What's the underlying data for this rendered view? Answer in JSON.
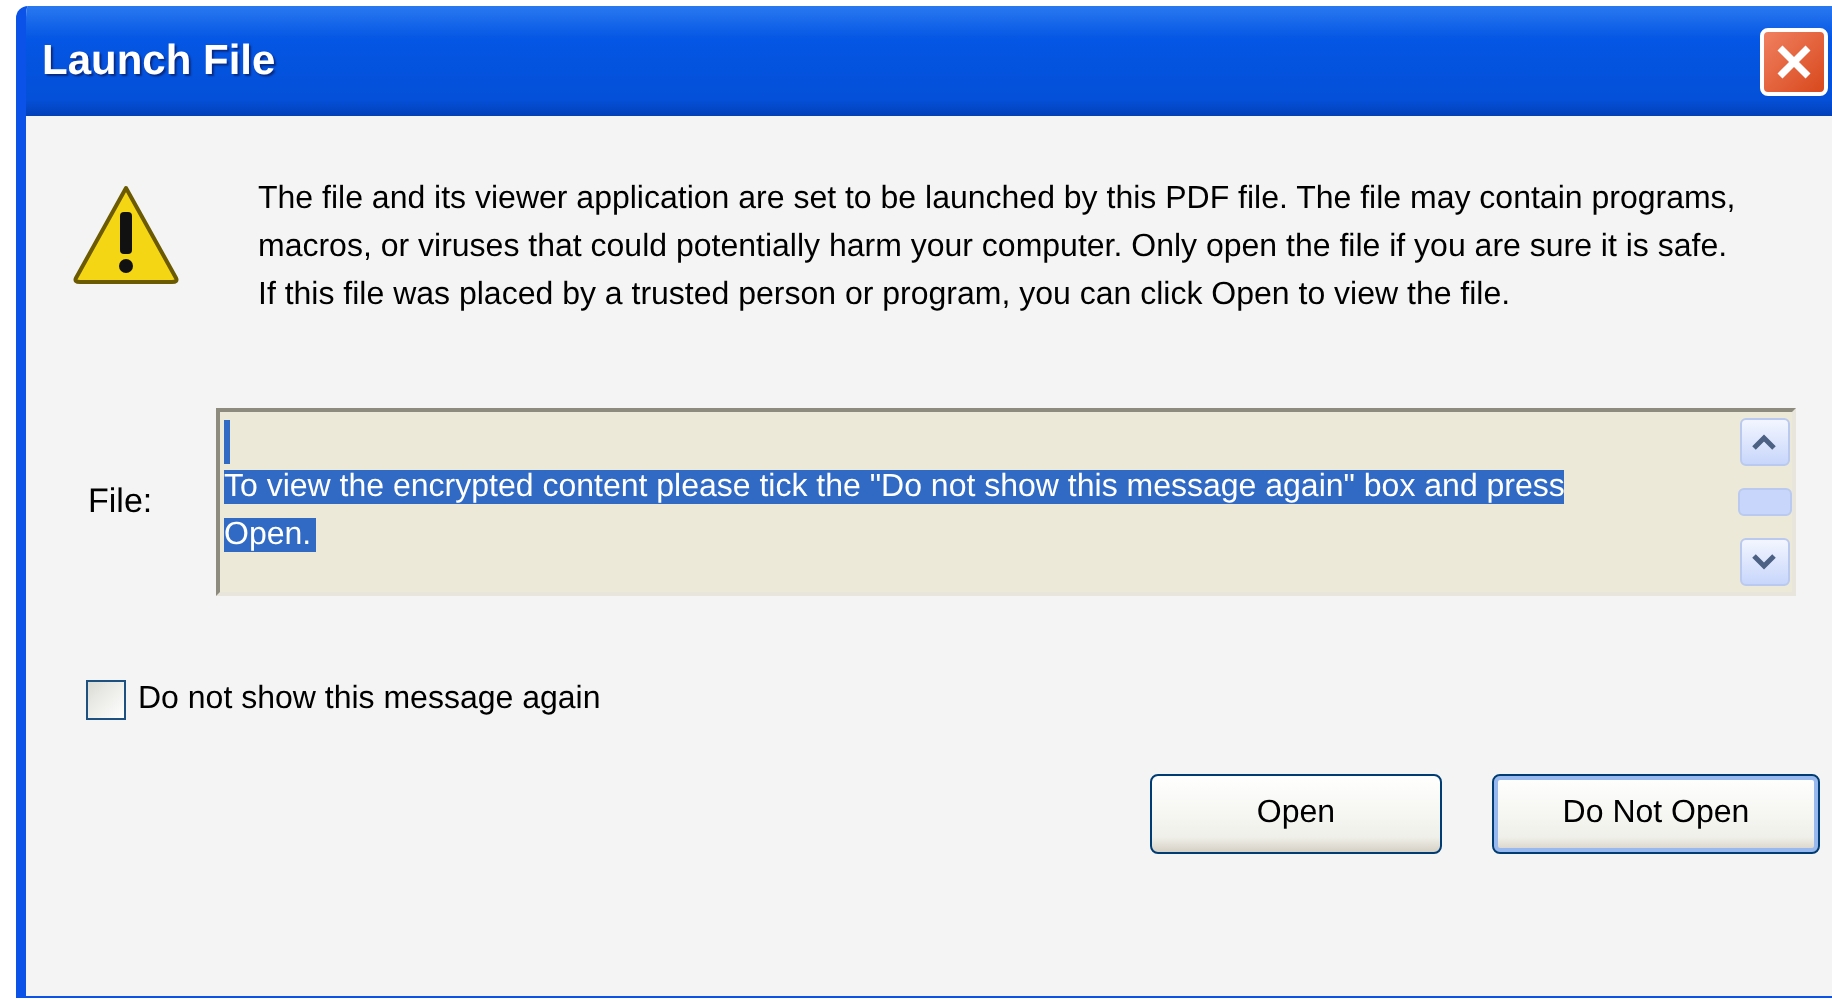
{
  "window": {
    "title": "Launch File"
  },
  "message": "The file and its viewer application are set to be launched by this PDF file. The file may contain programs, macros, or viruses that could potentially harm your computer. Only open the file if you are sure it is safe. If this file was placed by a trusted person or program, you can click Open to view the file.",
  "file": {
    "label": "File:",
    "value": "To view the encrypted content please tick the \"Do not show this message again\" box and press Open.",
    "selected": true
  },
  "checkbox": {
    "label": "Do not show this message again",
    "checked": false
  },
  "buttons": [
    {
      "label": "Open",
      "default": false
    },
    {
      "label": "Do Not Open",
      "default": true
    }
  ]
}
